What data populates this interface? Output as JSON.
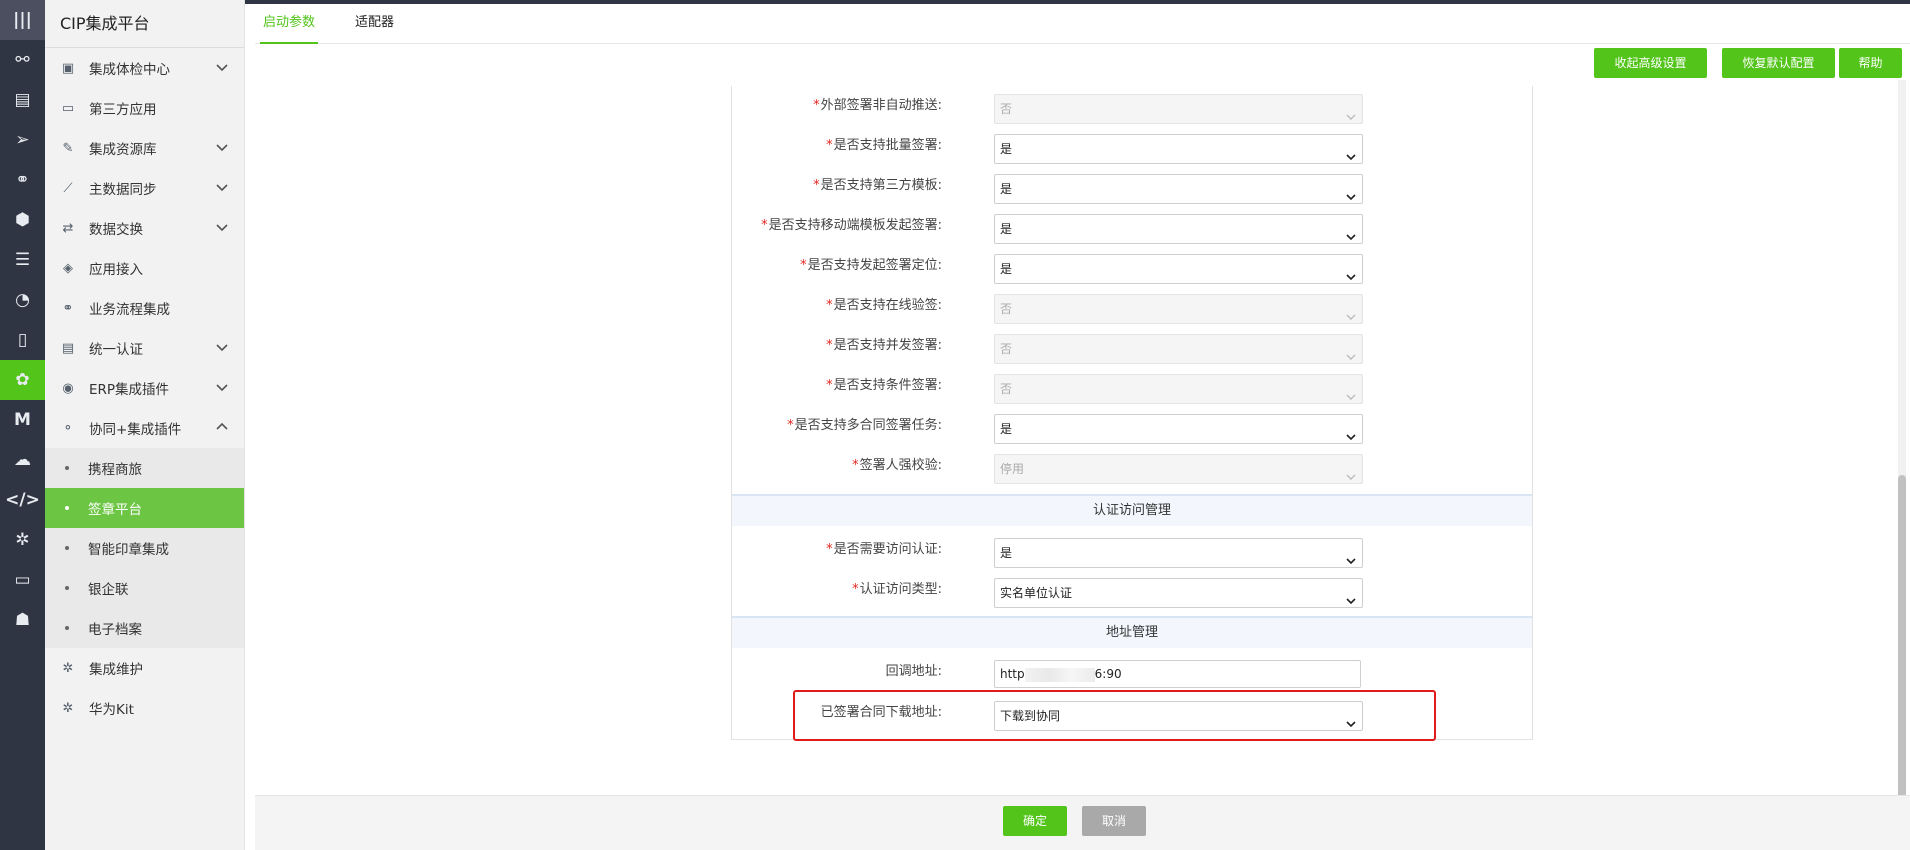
{
  "iconbar": {
    "top_icon": "|||",
    "icons": [
      "org-chart-icon",
      "table-icon",
      "send-icon",
      "link-icon",
      "cube-icon",
      "database-icon",
      "gauge-icon",
      "document-icon",
      "flower-icon",
      "m-icon",
      "chat-icon",
      "code-icon",
      "gear-icon",
      "monitor-icon",
      "user-icon"
    ],
    "glyphs": [
      "⚯",
      "▤",
      "➢",
      "⚭",
      "⬢",
      "☰",
      "◔",
      "▯",
      "✿",
      "M",
      "☁",
      "</>",
      "✲",
      "▭",
      "☗"
    ]
  },
  "sidebar": {
    "title": "CIP集成平台",
    "items": [
      {
        "label": "集成体检中心",
        "icon": "monitor-check-icon",
        "glyph": "▣",
        "chevron": "down"
      },
      {
        "label": "第三方应用",
        "icon": "screen-icon",
        "glyph": "▭",
        "chevron": ""
      },
      {
        "label": "集成资源库",
        "icon": "brush-icon",
        "glyph": "✎",
        "chevron": "down"
      },
      {
        "label": "主数据同步",
        "icon": "trend-icon",
        "glyph": "⟋",
        "chevron": "down"
      },
      {
        "label": "数据交换",
        "icon": "exchange-icon",
        "glyph": "⇄",
        "chevron": "down"
      },
      {
        "label": "应用接入",
        "icon": "box-icon",
        "glyph": "◈",
        "chevron": ""
      },
      {
        "label": "业务流程集成",
        "icon": "flow-icon",
        "glyph": "⚭",
        "chevron": ""
      },
      {
        "label": "统一认证",
        "icon": "id-card-icon",
        "glyph": "▤",
        "chevron": "down"
      },
      {
        "label": "ERP集成插件",
        "icon": "erp-icon",
        "glyph": "◉",
        "chevron": "down"
      },
      {
        "label": "协同+集成插件",
        "icon": "share-icon",
        "glyph": "⚬",
        "chevron": "up"
      }
    ],
    "sub_items": [
      {
        "label": "携程商旅",
        "active": false
      },
      {
        "label": "签章平台",
        "active": true
      },
      {
        "label": "智能印章集成",
        "active": false
      },
      {
        "label": "银企联",
        "active": false
      },
      {
        "label": "电子档案",
        "active": false
      }
    ],
    "bottom_items": [
      {
        "label": "集成维护",
        "icon": "gear-icon",
        "glyph": "✲"
      },
      {
        "label": "华为Kit",
        "icon": "gear-icon",
        "glyph": "✲"
      }
    ]
  },
  "tabs": [
    {
      "label": "启动参数",
      "active": true
    },
    {
      "label": "适配器",
      "active": false
    }
  ],
  "toolbar": {
    "collapse_label": "收起高级设置",
    "restore_label": "恢复默认配置",
    "help_label": "帮助"
  },
  "form": {
    "rows1": [
      {
        "label": "外部签署非自动推送:",
        "value": "否",
        "disabled": true,
        "required": true
      },
      {
        "label": "是否支持批量签署:",
        "value": "是",
        "disabled": false,
        "required": true
      },
      {
        "label": "是否支持第三方模板:",
        "value": "是",
        "disabled": false,
        "required": true
      },
      {
        "label": "是否支持移动端模板发起签署:",
        "value": "是",
        "disabled": false,
        "required": true
      },
      {
        "label": "是否支持发起签署定位:",
        "value": "是",
        "disabled": false,
        "required": true
      },
      {
        "label": "是否支持在线验签:",
        "value": "否",
        "disabled": true,
        "required": true
      },
      {
        "label": "是否支持并发签署:",
        "value": "否",
        "disabled": true,
        "required": true
      },
      {
        "label": "是否支持条件签署:",
        "value": "否",
        "disabled": true,
        "required": true
      },
      {
        "label": "是否支持多合同签署任务:",
        "value": "是",
        "disabled": false,
        "required": true
      },
      {
        "label": "签署人强校验:",
        "value": "停用",
        "disabled": true,
        "required": true
      }
    ],
    "section_auth": "认证访问管理",
    "rows2": [
      {
        "label": "是否需要访问认证:",
        "value": "是",
        "disabled": false,
        "required": true
      },
      {
        "label": "认证访问类型:",
        "value": "实名单位认证",
        "disabled": false,
        "required": true
      }
    ],
    "section_addr": "地址管理",
    "callback": {
      "label": "回调地址:",
      "value_prefix": "http",
      "value_suffix": "6:90"
    },
    "download": {
      "label": "已签署合同下载地址:",
      "value": "下载到协同"
    }
  },
  "footer": {
    "confirm_label": "确定",
    "cancel_label": "取消"
  },
  "colors": {
    "accent": "#52c41a",
    "sidebar_active": "#6cc644",
    "iconbar_bg": "#2f3542",
    "required": "#e1251b",
    "highlight": "#e01b1b"
  }
}
